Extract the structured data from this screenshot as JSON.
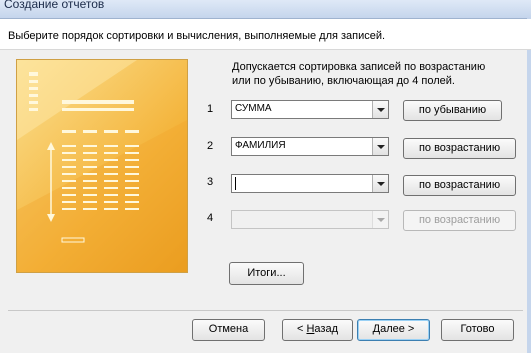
{
  "window": {
    "title": "Создание отчетов"
  },
  "header": {
    "text": "Выберите порядок сортировки и вычисления, выполняемые для записей."
  },
  "instructions": "Допускается сортировка записей по возрастанию или по убыванию, включающая до 4 полей.",
  "sort_rows": [
    {
      "number": "1",
      "field": "СУММА",
      "order_label": "по убыванию",
      "enabled": true
    },
    {
      "number": "2",
      "field": "ФАМИЛИЯ",
      "order_label": "по возрастанию",
      "enabled": true
    },
    {
      "number": "3",
      "field": "",
      "order_label": "по возрастанию",
      "enabled": true,
      "focused": true
    },
    {
      "number": "4",
      "field": "",
      "order_label": "по возрастанию",
      "enabled": false
    }
  ],
  "summary_button": "Итоги...",
  "footer": {
    "cancel": "Отмена",
    "back_prefix": "< ",
    "back_mnemonic": "Н",
    "back_rest": "азад",
    "next_prefix": "",
    "next_mnemonic": "Д",
    "next_rest": "алее >",
    "finish": "Готово"
  },
  "colors": {
    "illustration_light": "#fbe090",
    "illustration_dark": "#e89a1a"
  }
}
